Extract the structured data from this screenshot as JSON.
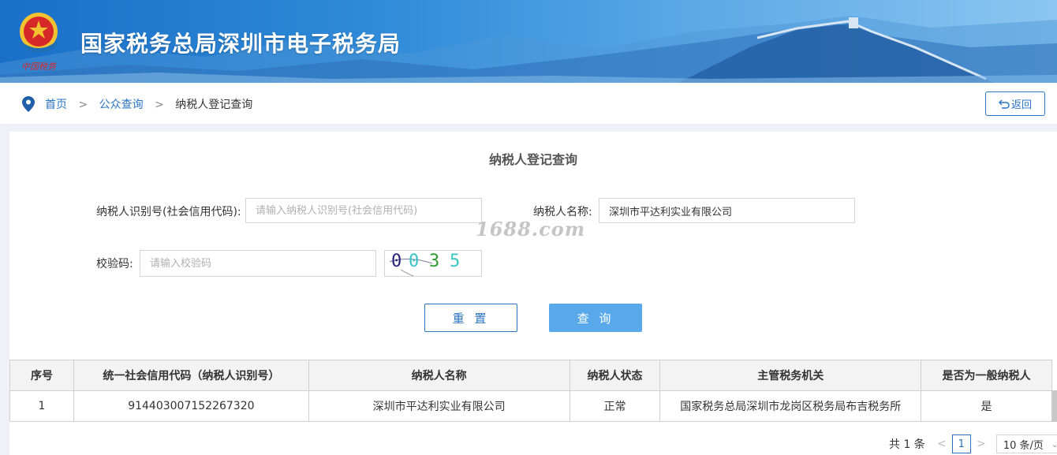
{
  "header": {
    "site_title": "国家税务总局深圳市电子税务局",
    "emblem_icon": "tax-emblem-icon",
    "brand_colors": {
      "banner_start": "#1a6fc8",
      "banner_end": "#8cc6f0"
    }
  },
  "breadcrumb": {
    "home": "首页",
    "sep1": ">",
    "public_query": "公众查询",
    "sep2": ">",
    "current": "纳税人登记查询"
  },
  "back_button": {
    "icon": "return-arrow-icon",
    "label": "返回"
  },
  "form": {
    "title": "纳税人登记查询",
    "taxpayer_id": {
      "label": "纳税人识别号(社会信用代码):",
      "placeholder": "请输入纳税人识别号(社会信用代码)",
      "value": ""
    },
    "taxpayer_name": {
      "label": "纳税人名称:",
      "value": "深圳市平达利实业有限公司"
    },
    "captcha": {
      "label": "校验码:",
      "placeholder": "请输入校验码",
      "value": "",
      "image_chars": [
        "0",
        "0",
        "3",
        "5"
      ]
    },
    "reset_label": "重 置",
    "query_label": "查 询"
  },
  "watermark": "1688.com",
  "table": {
    "headers": [
      "序号",
      "统一社会信用代码（纳税人识别号）",
      "纳税人名称",
      "纳税人状态",
      "主管税务机关",
      "是否为一般纳税人"
    ],
    "rows": [
      [
        "1",
        "914403007152267320",
        "深圳市平达利实业有限公司",
        "正常",
        "国家税务总局深圳市龙岗区税务局布吉税务所",
        "是"
      ]
    ]
  },
  "pagination": {
    "total": "共 1 条",
    "prev": "<",
    "page": "1",
    "next": ">",
    "page_size": "10 条/页"
  },
  "colors": {
    "accent": "#2a74c4",
    "query_button": "#59a8ea"
  }
}
